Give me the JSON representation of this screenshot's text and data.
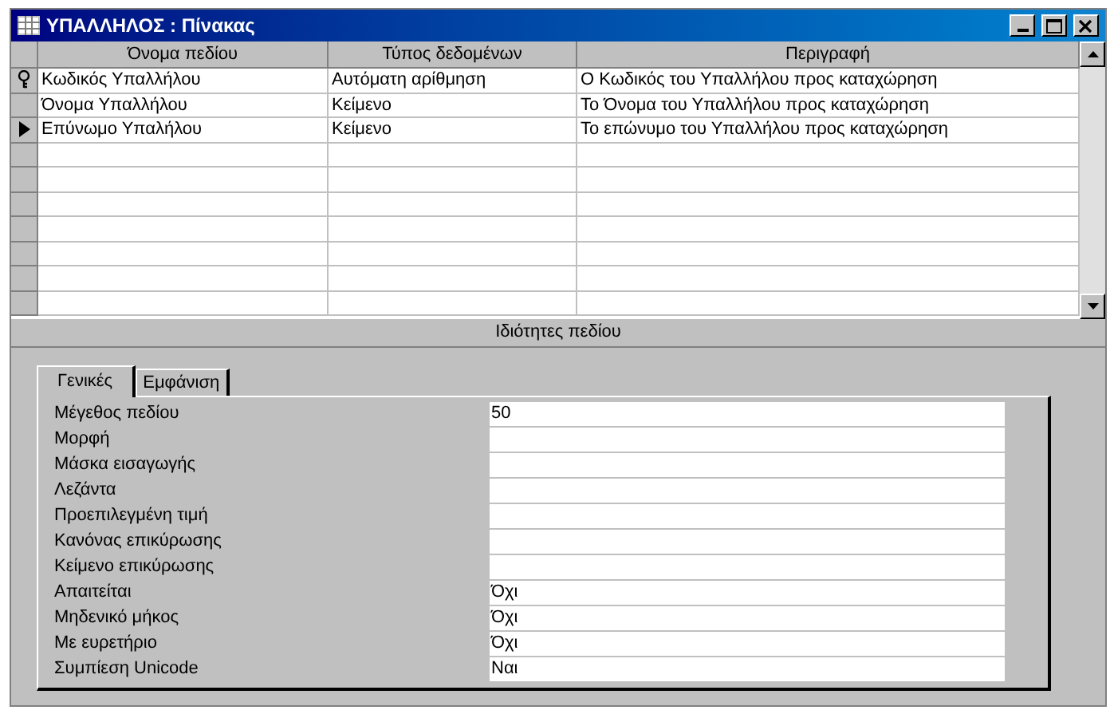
{
  "window": {
    "title": "ΥΠΑΛΛΗΛΟΣ : Πίνακας"
  },
  "table": {
    "columns": [
      "Όνομα πεδίου",
      "Τύπος δεδομένων",
      "Περιγραφή"
    ],
    "rows": [
      {
        "kind": "key",
        "cells": [
          "Κωδικός Υπαλλήλου",
          "Αυτόματη αρίθμηση",
          "Ο Κωδικός του Υπαλλήλου προς καταχώρηση"
        ]
      },
      {
        "kind": "plain",
        "cells": [
          "Όνομα Υπαλλήλου",
          "Κείμενο",
          "Το Όνομα του Υπαλλήλου προς καταχώρηση"
        ]
      },
      {
        "kind": "current",
        "cells": [
          "Επύνωμο Υπαλήλου",
          "Κείμενο",
          "Το επώνυμο του Υπαλλήλου προς καταχώρηση"
        ]
      }
    ]
  },
  "properties": {
    "title": "Ιδιότητες πεδίου",
    "tabs": [
      {
        "label": "Γενικές",
        "selected": true
      },
      {
        "label": "Εμφάνιση",
        "selected": false
      }
    ],
    "fields": [
      {
        "label": "Μέγεθος πεδίου",
        "value": "50"
      },
      {
        "label": "Μορφή"
      },
      {
        "label": "Μάσκα εισαγωγής"
      },
      {
        "label": "Λεζάντα"
      },
      {
        "label": "Προεπιλεγμένη τιμή"
      },
      {
        "label": "Κανόνας επικύρωσης"
      },
      {
        "label": "Κείμενο επικύρωσης"
      },
      {
        "label": "Απαιτείται",
        "value": "Όχι"
      },
      {
        "label": "Μηδενικό μήκος",
        "value": "Όχι"
      },
      {
        "label": "Με ευρετήριο",
        "value": "Όχι"
      },
      {
        "label": "Συμπίεση Unicode",
        "value": "Ναι"
      }
    ]
  }
}
